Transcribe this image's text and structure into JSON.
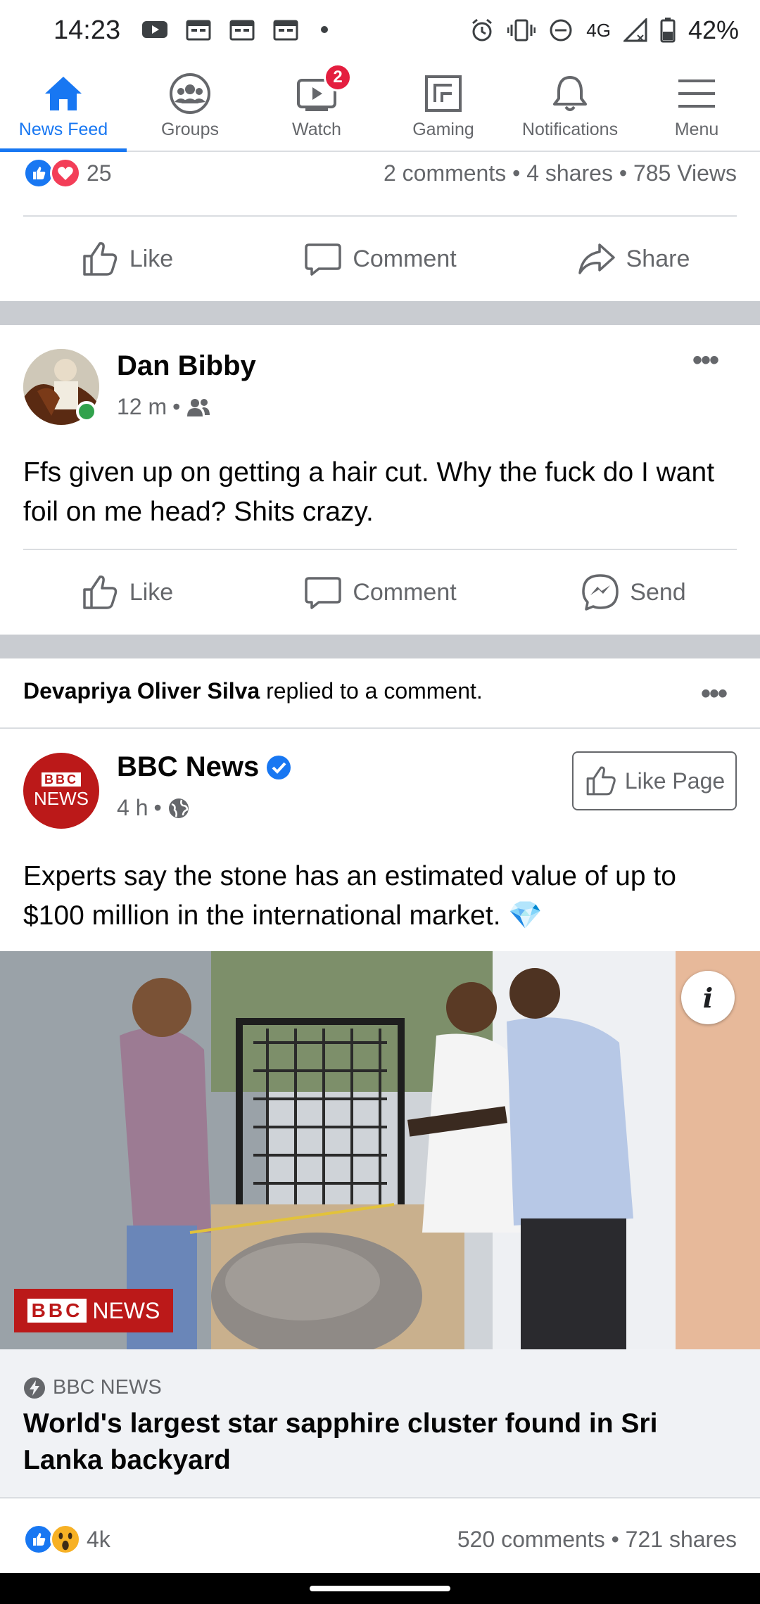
{
  "status_bar": {
    "time": "14:23",
    "network": "4G",
    "battery": "42%"
  },
  "nav": {
    "items": [
      {
        "label": "News Feed",
        "icon": "home-icon"
      },
      {
        "label": "Groups",
        "icon": "groups-icon"
      },
      {
        "label": "Watch",
        "icon": "watch-icon",
        "badge": "2"
      },
      {
        "label": "Gaming",
        "icon": "gaming-icon"
      },
      {
        "label": "Notifications",
        "icon": "bell-icon"
      },
      {
        "label": "Menu",
        "icon": "menu-icon"
      }
    ],
    "active_color": "#1877f2"
  },
  "post1": {
    "reaction_count": "25",
    "stats": "2 comments • 4 shares • 785 Views",
    "actions": [
      "Like",
      "Comment",
      "Share"
    ]
  },
  "post2": {
    "author": "Dan Bibby",
    "time": "12 m",
    "audience_icon": "friends-icon",
    "text": "Ffs given up on getting a hair cut. Why the fuck do I want foil on me head? Shits crazy.",
    "actions": [
      "Like",
      "Comment",
      "Send"
    ]
  },
  "post3": {
    "activity_actor": "Devapriya Oliver Silva",
    "activity_text": " replied to a comment.",
    "author": "BBC News",
    "verified": true,
    "time": "4 h",
    "audience_icon": "globe-icon",
    "like_page_label": "Like Page",
    "text": "Experts say the stone has an estimated value of up to $100 million in the international market. 💎",
    "avatar_text_top": "BBC",
    "avatar_text_bottom": "NEWS",
    "image_watermark_bbc": "BBC",
    "image_watermark_news": "NEWS",
    "link_domain": "BBC NEWS",
    "link_title": "World's largest star sapphire cluster found in Sri Lanka backyard",
    "reaction_count": "4k",
    "stats": "520 comments • 721 shares"
  },
  "colors": {
    "brand_blue": "#1877f2",
    "separator": "#c9ccd1",
    "bbc_red": "#bb1919",
    "online_green": "#31a24c"
  }
}
